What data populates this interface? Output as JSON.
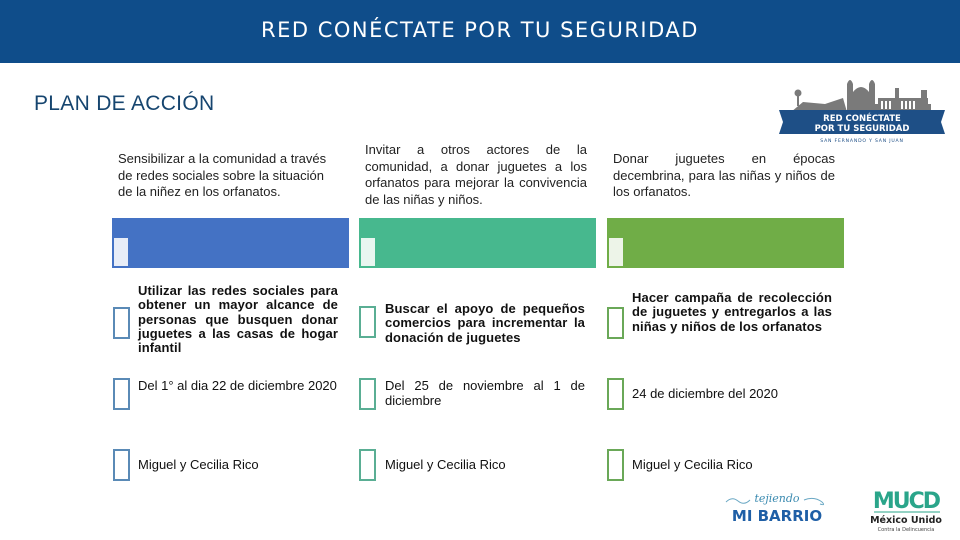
{
  "header": {
    "title": "RED CONÉCTATE POR TU SEGURIDAD"
  },
  "page_title": "PLAN DE ACCIÓN",
  "logos": {
    "top_right": {
      "line1": "RED CONÉCTATE",
      "line2": "POR TU SEGURIDAD",
      "subtitle": "SAN FERNANDO Y SAN JUAN"
    },
    "footer_left": {
      "script": "tejiendo",
      "title": "MI BARRIO"
    },
    "footer_right": {
      "mark": "MUCD",
      "name": "México Unido",
      "tagline": "Contra la Delincuencia"
    }
  },
  "colors": {
    "header": "#0f4d8a",
    "title": "#16456f",
    "column_1": "#4472c4",
    "column_2": "#47b88e",
    "column_3": "#70ad47"
  },
  "columns": [
    {
      "objective": "Sensibilizar a la comunidad a través de redes sociales sobre la situación de la niñez en los orfanatos.",
      "action": "Utilizar las redes sociales para obtener un mayor alcance de personas que busquen donar juguetes a las casas de hogar infantil",
      "dates": "Del 1° al dia 22 de diciembre 2020",
      "responsible": "Miguel y Cecilia Rico"
    },
    {
      "objective": "Invitar a otros actores de la comunidad, a donar juguetes a los orfanatos para mejorar la convivencia de las niñas y niños.",
      "action": "Buscar el apoyo de pequeños comercios para incrementar la donación de juguetes",
      "dates": "Del 25 de noviembre al 1 de diciembre",
      "responsible": "Miguel y Cecilia Rico"
    },
    {
      "objective": "Donar juguetes en épocas decembrina, para las niñas y niños de los orfanatos.",
      "action": "Hacer campaña de recolección de juguetes y entregarlos a las niñas y niños de los orfanatos",
      "dates": "24 de diciembre del 2020",
      "responsible": "Miguel y Cecilia Rico"
    }
  ]
}
